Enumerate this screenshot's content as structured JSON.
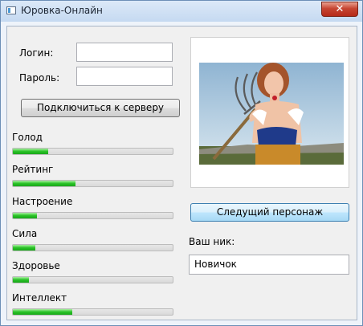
{
  "window": {
    "title": "Юровка-Онлайн",
    "close_glyph": "✕"
  },
  "login": {
    "login_label": "Логин:",
    "login_value": "",
    "password_label": "Пароль:",
    "password_value": ""
  },
  "connect_button_label": "Подключиться к серверу",
  "stats": [
    {
      "label": "Голод",
      "percent": 22
    },
    {
      "label": "Рейтинг",
      "percent": 39
    },
    {
      "label": "Настроение",
      "percent": 15
    },
    {
      "label": "Сила",
      "percent": 14
    },
    {
      "label": "Здоровье",
      "percent": 10
    },
    {
      "label": "Интеллект",
      "percent": 37
    }
  ],
  "character": {
    "next_button_label": "Следущий персонаж",
    "nick_label": "Ваш ник:",
    "nick_value": "Новичок"
  },
  "colors": {
    "progress_fill": "#29c226",
    "window_border": "#6d8fb7",
    "close_button": "#c64532"
  }
}
